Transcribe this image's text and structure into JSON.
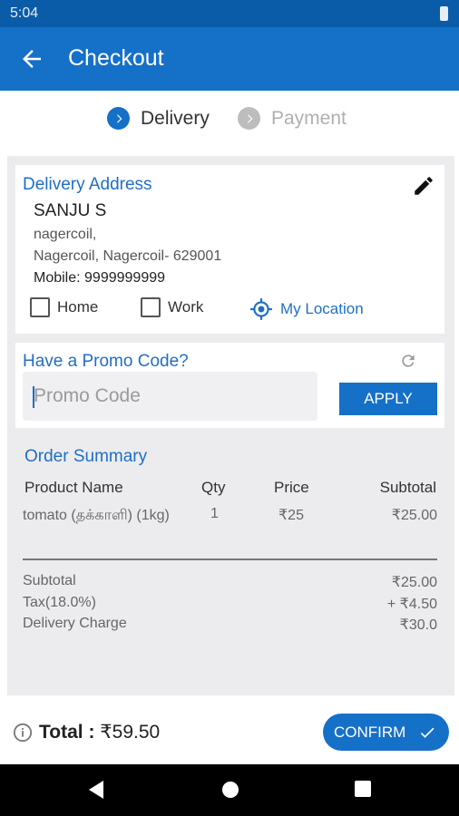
{
  "status_bar": {
    "time": "5:04"
  },
  "app_bar": {
    "title": "Checkout"
  },
  "steps": [
    {
      "label": "Delivery",
      "active": true
    },
    {
      "label": "Payment",
      "active": false
    }
  ],
  "address": {
    "section_title": "Delivery Address",
    "name": "SANJU S",
    "line1": "nagercoil,",
    "line2": "Nagercoil, Nagercoil- 629001",
    "mobile": "Mobile: 9999999999",
    "types": [
      "Home",
      "Work",
      "My Location"
    ]
  },
  "promo": {
    "section_title": "Have a Promo Code?",
    "placeholder": "Promo Code",
    "apply_label": "APPLY"
  },
  "order_summary": {
    "title": "Order Summary",
    "headers": [
      "Product Name",
      "Qty",
      "Price",
      "Subtotal"
    ],
    "rows": [
      {
        "product": "tomato (தக்காளி) (1kg)",
        "qty": "1",
        "price": "₹25",
        "subtotal": "₹25.00"
      }
    ],
    "totals": [
      {
        "label": "Subtotal",
        "value": "₹25.00"
      },
      {
        "label": "Tax(18.0%)",
        "value": "+ ₹4.50"
      },
      {
        "label": "Delivery Charge",
        "value": "₹30.0"
      }
    ]
  },
  "bottom": {
    "total_label": "Total :",
    "total_value": "₹59.50",
    "confirm_label": "CONFIRM"
  },
  "colors": {
    "primary": "#1570c8",
    "status_bar": "#0b5ca8",
    "link": "#1f6fc4"
  }
}
